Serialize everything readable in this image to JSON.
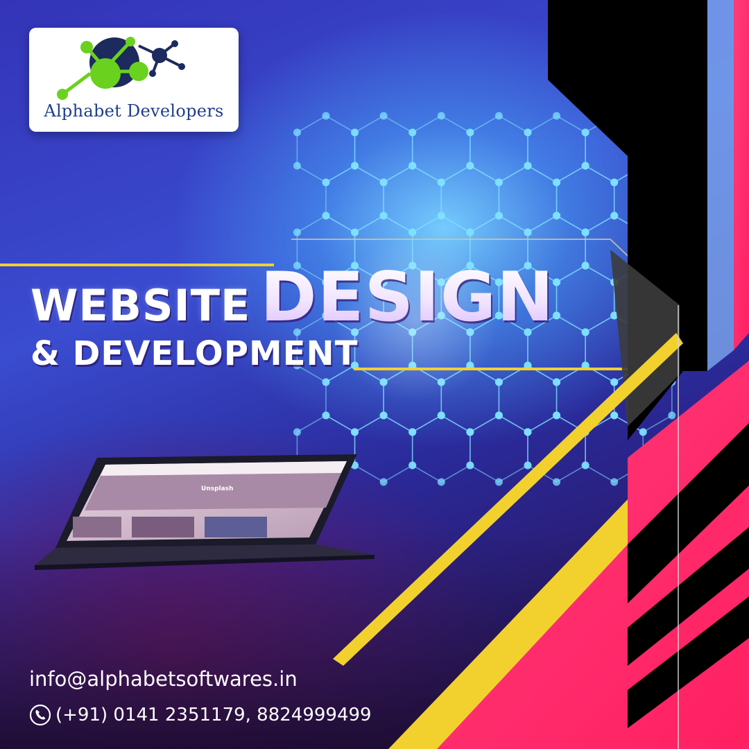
{
  "brand": {
    "name": "Alphabet Developers",
    "logo_icon": "molecule-icon",
    "colors": {
      "logo_green": "#6ad11f",
      "logo_navy": "#1e3d8f",
      "logo_dark": "#1c2a5e"
    }
  },
  "headline": {
    "word1": "WEBSITE",
    "word2": "DESIGN",
    "line2": "& DEVELOPMENT"
  },
  "contact": {
    "email": "info@alphabetsoftwares.in",
    "phone": "(+91) 0141 2351179, 8824999499",
    "phone_icon": "phone-icon"
  },
  "laptop_screen": {
    "label": "Unsplash"
  },
  "colors": {
    "accent_yellow": "#f2d12e",
    "accent_pink": "#ff2d6f",
    "accent_black": "#000000",
    "hex_node": "#7fe0ff"
  }
}
